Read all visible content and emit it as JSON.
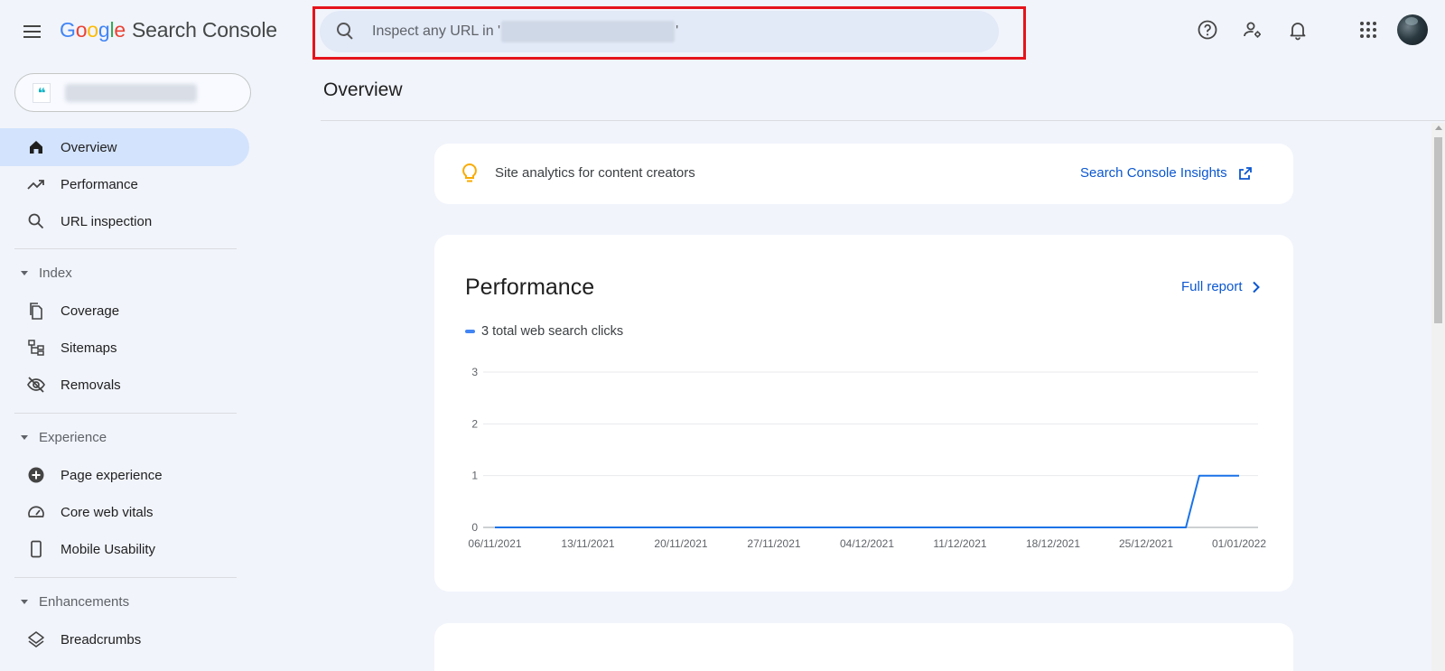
{
  "app": {
    "logo_letters": [
      "G",
      "o",
      "o",
      "g",
      "l",
      "e"
    ],
    "product": "Search Console"
  },
  "search": {
    "prefix": "Inspect any URL in '",
    "suffix": "'"
  },
  "sidebar": {
    "items": [
      {
        "label": "Overview",
        "icon": "home-icon",
        "active": true
      },
      {
        "label": "Performance",
        "icon": "trending-up-icon"
      },
      {
        "label": "URL inspection",
        "icon": "search-icon"
      }
    ],
    "sections": [
      {
        "label": "Index",
        "items": [
          {
            "label": "Coverage",
            "icon": "file-copy-icon"
          },
          {
            "label": "Sitemaps",
            "icon": "sitemap-icon"
          },
          {
            "label": "Removals",
            "icon": "visibility-off-icon"
          }
        ]
      },
      {
        "label": "Experience",
        "items": [
          {
            "label": "Page experience",
            "icon": "add-circle-icon"
          },
          {
            "label": "Core web vitals",
            "icon": "speed-icon"
          },
          {
            "label": "Mobile Usability",
            "icon": "smartphone-icon"
          }
        ]
      },
      {
        "label": "Enhancements",
        "items": [
          {
            "label": "Breadcrumbs",
            "icon": "layers-icon"
          }
        ]
      }
    ]
  },
  "main": {
    "title": "Overview",
    "insight": {
      "text": "Site analytics for content creators",
      "link": "Search Console Insights"
    },
    "performance": {
      "title": "Performance",
      "full_report": "Full report",
      "legend": "3 total web search clicks"
    }
  },
  "colors": {
    "accent": "#0b57d0",
    "line": "#1a73e8",
    "active_nav": "#d3e3fd",
    "highlight_frame": "#e5131b"
  },
  "chart_data": {
    "type": "line",
    "series": [
      {
        "name": "3 total web search clicks",
        "values": [
          0,
          0,
          0,
          0,
          0,
          0,
          0,
          0,
          0,
          0,
          0,
          0,
          0,
          0,
          0,
          0,
          0,
          0,
          0,
          0,
          0,
          0,
          0,
          0,
          0,
          0,
          0,
          0,
          0,
          0,
          0,
          0,
          0,
          0,
          0,
          0,
          0,
          0,
          0,
          0,
          0,
          0,
          0,
          0,
          0,
          0,
          0,
          0,
          0,
          0,
          0,
          0,
          0,
          1,
          1,
          1,
          1
        ]
      }
    ],
    "x_start": "06/11/2021",
    "x_ticks": [
      "06/11/2021",
      "13/11/2021",
      "20/11/2021",
      "27/11/2021",
      "04/12/2021",
      "11/12/2021",
      "18/12/2021",
      "25/12/2021",
      "01/01/2022"
    ],
    "y_ticks": [
      "0",
      "1",
      "2",
      "3"
    ],
    "ylim": [
      0,
      3
    ],
    "grid": true
  }
}
